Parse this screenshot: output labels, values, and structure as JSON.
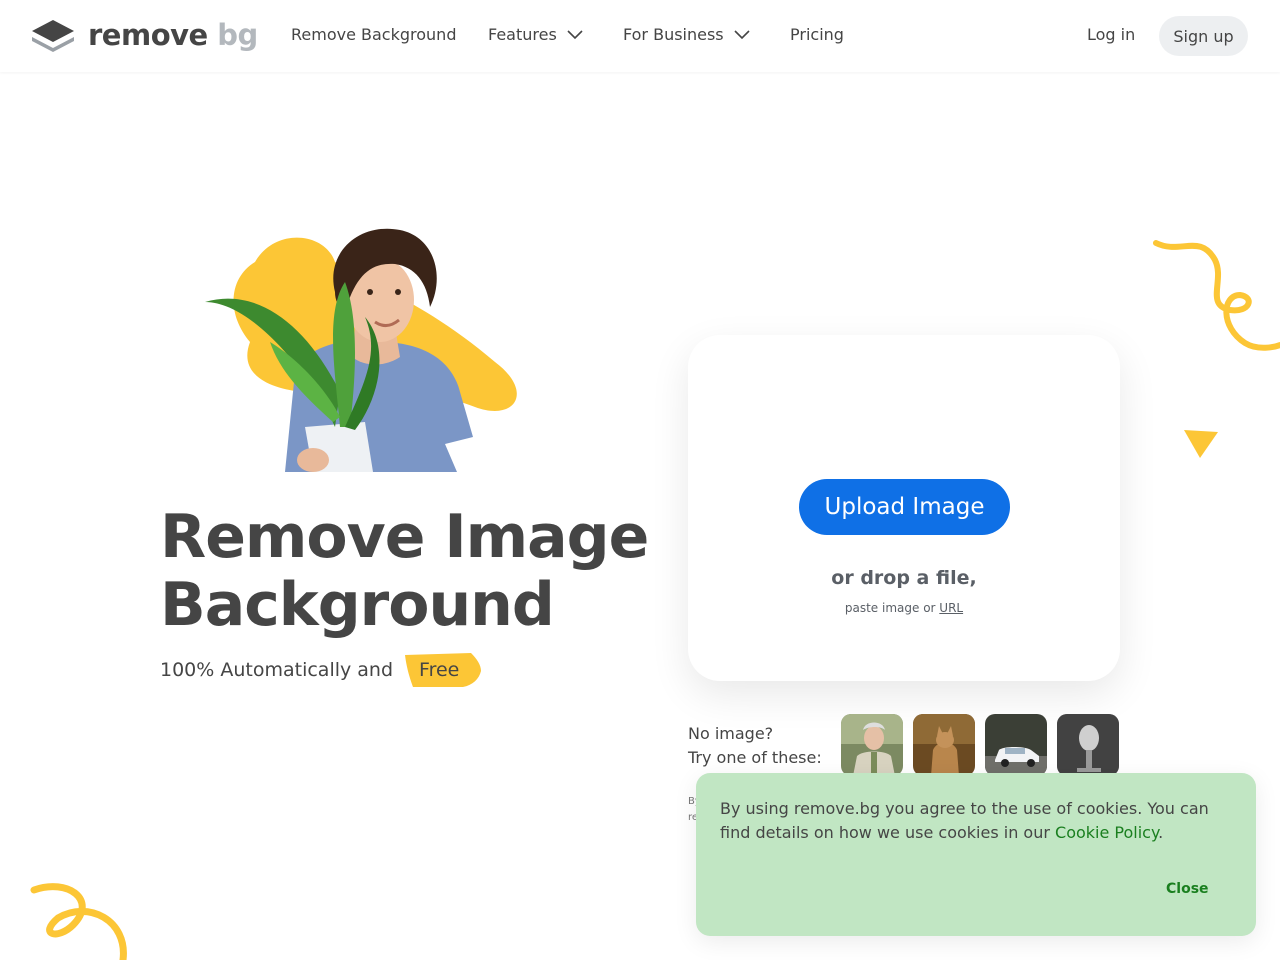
{
  "header": {
    "logo_word1": "remove",
    "logo_word2": "bg",
    "nav": [
      {
        "label": "Remove Background"
      },
      {
        "label": "Features"
      },
      {
        "label": "For Business"
      },
      {
        "label": "Pricing"
      }
    ],
    "login_label": "Log in",
    "signup_label": "Sign up"
  },
  "hero": {
    "title_line1": "Remove Image",
    "title_line2": "Background",
    "subtitle": "100% Automatically and",
    "free_badge": "Free"
  },
  "upload": {
    "button_label": "Upload Image",
    "drop_text": "or drop a file,",
    "paste_text": "paste image or",
    "url_link": "URL"
  },
  "samples": {
    "line1": "No image?",
    "line2": "Try one of these:",
    "fineprint_line1": "By",
    "fineprint_line2": "re"
  },
  "cookie": {
    "text": "By using remove.bg you agree to the use of cookies. You can find details on how we use cookies in our",
    "link": "Cookie Policy",
    "period": ".",
    "close_label": "Close"
  },
  "colors": {
    "accent_blue": "#0f70e6",
    "brand_yellow": "#fcc636",
    "cookie_bg": "#c1e6c3",
    "cookie_link": "#1a7f1f",
    "text_dark": "#454545"
  }
}
